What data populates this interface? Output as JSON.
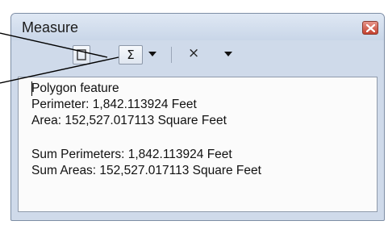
{
  "window": {
    "title": "Measure"
  },
  "toolbar": {
    "buttons": [
      {
        "icon": "measure-area-icon"
      },
      {
        "icon": "sum-icon",
        "glyph": "Σ"
      },
      {
        "icon": "clear-icon",
        "glyph": "×"
      }
    ]
  },
  "results": {
    "lines": [
      "Polygon feature",
      "Perimeter: 1,842.113924 Feet",
      "Area: 152,527.017113 Square Feet",
      "Sum Perimeters: 1,842.113924 Feet",
      "Sum Areas: 152,527.017113 Square Feet"
    ]
  },
  "colors": {
    "window_frame": "#cfdaea",
    "close_button": "#c4412f",
    "panel_background": "#fbfbfb"
  }
}
